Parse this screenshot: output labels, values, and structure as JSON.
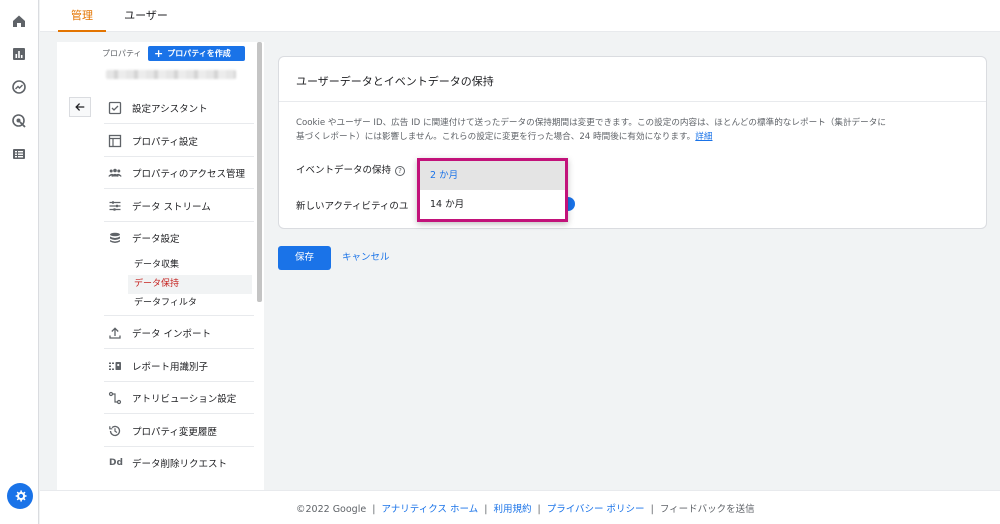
{
  "rail": {
    "icons": [
      "home-icon",
      "reports-icon",
      "explore-icon",
      "advertising-icon",
      "configure-icon",
      "admin-gear-icon"
    ]
  },
  "tabs": [
    {
      "label": "管理",
      "active": true
    },
    {
      "label": "ユーザー",
      "active": false
    }
  ],
  "nav": {
    "property_label": "プロパティ",
    "create_button": "プロパティを作成",
    "items": [
      {
        "label": "設定アシスタント",
        "icon": "checkbox-icon"
      },
      {
        "label": "プロパティ設定",
        "icon": "layout-icon"
      },
      {
        "label": "プロパティのアクセス管理",
        "icon": "people-icon"
      },
      {
        "label": "データ ストリーム",
        "icon": "streams-icon"
      },
      {
        "label": "データ設定",
        "icon": "database-icon"
      },
      {
        "label": "データ インポート",
        "icon": "upload-icon"
      },
      {
        "label": "レポート用識別子",
        "icon": "identifier-icon"
      },
      {
        "label": "アトリビューション設定",
        "icon": "attribution-icon"
      },
      {
        "label": "プロパティ変更履歴",
        "icon": "history-icon"
      },
      {
        "label": "データ削除リクエスト",
        "icon": "dd-icon"
      }
    ],
    "sub_items": [
      {
        "label": "データ収集",
        "active": false
      },
      {
        "label": "データ保持",
        "active": true
      },
      {
        "label": "データフィルタ",
        "active": false
      }
    ]
  },
  "card": {
    "title": "ユーザーデータとイベントデータの保持",
    "desc_line1": "Cookie やユーザー ID、広告 ID に関連付けて送ったデータの保持期間は変更できます。この設定の内容は、ほとんどの標準的なレポート（集計データに",
    "desc_line2": "基づくレポート）には影響しません。これらの設定に変更を行った場合、24 時間後に有効になります。",
    "desc_link": "詳細",
    "event_label": "イベントデータの保持",
    "help_glyph": "?",
    "new_activity_label": "新しいアクティビティのユ"
  },
  "dropdown": {
    "options": [
      {
        "label": "2 か月",
        "selected": true
      },
      {
        "label": "14 か月",
        "selected": false
      }
    ]
  },
  "actions": {
    "save": "保存",
    "cancel": "キャンセル"
  },
  "footer": {
    "copyright": "©2022 Google",
    "links": [
      "アナリティクス ホーム",
      "利用規約",
      "プライバシー ポリシー"
    ],
    "feedback": "フィードバックを送信",
    "separator": "|"
  },
  "colors": {
    "accent": "#1a73e8",
    "active_tab": "#e37400",
    "active_subitem": "#c5221f",
    "dropdown_highlight": "#c2127a"
  }
}
